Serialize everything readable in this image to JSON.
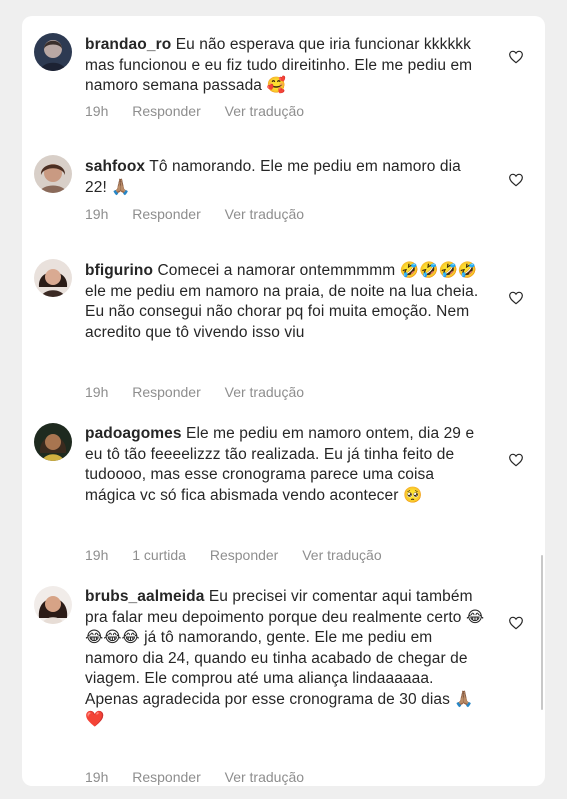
{
  "comments": [
    {
      "username": "brandao_ro",
      "text": "Eu não esperava que iria funcionar kkkkkk mas funcionou e eu fiz tudo direitinho. Ele me pediu em namoro semana passada",
      "emoji": "🥰",
      "time": "19h",
      "reply": "Responder",
      "translate": "Ver tradução"
    },
    {
      "username": "sahfoox",
      "text": "Tô namorando. Ele me pediu em namoro dia 22!",
      "emoji": "🙏🏽",
      "time": "19h",
      "reply": "Responder",
      "translate": "Ver tradução"
    },
    {
      "username": "bfigurino",
      "text_a": "Comecei a namorar ontemmmmm",
      "emojis_a": "🤣🤣🤣🤣",
      "text_b": "ele me pediu em namoro na praia, de noite na lua cheia. Eu não consegui não chorar pq foi muita emoção. Nem acredito que tô vivendo isso viu",
      "time": "19h",
      "reply": "Responder",
      "translate": "Ver tradução"
    },
    {
      "username": "padoagomes",
      "text": "Ele me pediu em namoro ontem, dia 29 e eu tô tão feeeelizzz tão realizada. Eu já tinha feito de tudoooo, mas esse cronograma parece uma coisa mágica vc só fica abismada vendo acontecer",
      "emoji": "🥺",
      "time": "19h",
      "likes": "1 curtida",
      "reply": "Responder",
      "translate": "Ver tradução"
    },
    {
      "username": "brubs_aalmeida",
      "text_a": "Eu precisei vir comentar aqui também pra falar meu depoimento porque deu realmente certo",
      "emojis_a": "😂😂😂😂",
      "text_b": "já tô namorando, gente. Ele me pediu em namoro dia 24, quando eu tinha acabado de chegar de viagem. Ele comprou até uma aliança lindaaaaaa. Apenas agradecida por esse cronograma de 30 dias",
      "emojis_b": "🙏🏽❤️",
      "time": "19h",
      "reply": "Responder",
      "translate": "Ver tradução"
    }
  ],
  "icons": {
    "like": "heart-outline-icon"
  },
  "colors": {
    "background": "#efefef",
    "card": "#ffffff",
    "text": "#262626",
    "meta": "#8e8e8e"
  }
}
